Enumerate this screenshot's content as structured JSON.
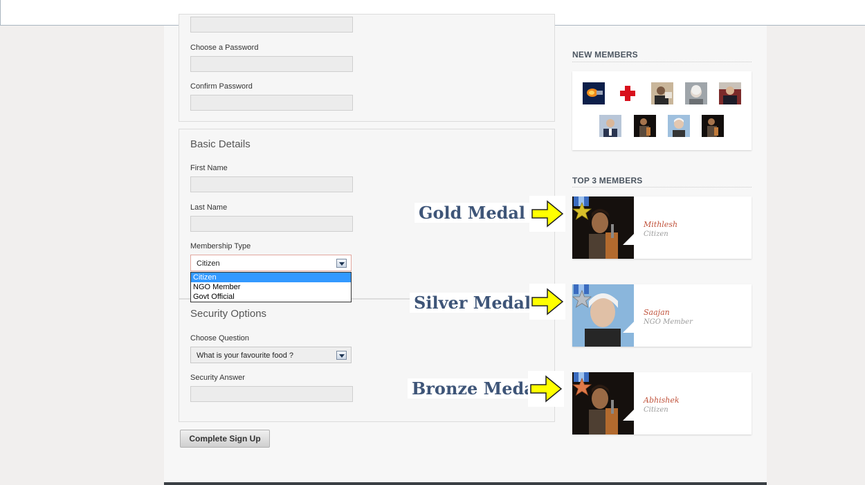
{
  "form": {
    "password_label": "Choose a Password",
    "confirm_label": "Confirm Password",
    "basic_title": "Basic Details",
    "first_name_label": "First Name",
    "last_name_label": "Last Name",
    "membership_label": "Membership Type",
    "membership_value": "Citizen",
    "membership_options": [
      "Citizen",
      "NGO Member",
      "Govt Official"
    ],
    "security_title": "Security Options",
    "question_label": "Choose Question",
    "question_value": "What is your favourite food ?",
    "answer_label": "Security Answer",
    "submit_label": "Complete Sign Up"
  },
  "sidebar": {
    "new_members_title": "NEW MEMBERS",
    "top_members_title": "TOP 3 MEMBERS",
    "new_members": [
      {
        "icon": "fire-avatar"
      },
      {
        "icon": "red-cross-avatar"
      },
      {
        "icon": "man-avatar"
      },
      {
        "icon": "grey-hair-avatar"
      },
      {
        "icon": "suit-avatar"
      },
      {
        "icon": "businessman-avatar"
      },
      {
        "icon": "guitarist-avatar"
      },
      {
        "icon": "white-hair-avatar"
      },
      {
        "icon": "guitarist-avatar"
      }
    ],
    "top_members": [
      {
        "name": "Mithlesh",
        "type": "Citizen",
        "medal": "Gold Medal",
        "medal_color": "#d8c02a"
      },
      {
        "name": "Saajan",
        "type": "NGO Member",
        "medal": "Silver Medal",
        "medal_color": "#b8bec6"
      },
      {
        "name": "Abhishek",
        "type": "Citizen",
        "medal": "Bronze Medal",
        "medal_color": "#e07a4a"
      }
    ]
  },
  "colors": {
    "accent_name": "#c0533c",
    "medal_text": "#3e5578",
    "arrow_yellow": "#ffff00"
  }
}
